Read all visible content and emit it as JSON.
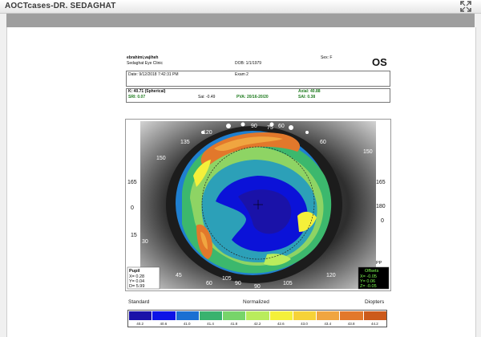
{
  "window": {
    "title": "AOCTcases-DR. SEDAGHAT"
  },
  "patient": {
    "name": "ebrahimi,vajiheh",
    "clinic": "Sedaghat Eye Clinic",
    "dob": "DOB: 1/1/1979",
    "sex": "Sex: F",
    "eye": "OS",
    "date": "Date: 9/12/2018 7:42:31 PM",
    "exam": "Exam 2"
  },
  "indices": {
    "k": "K: 40.71 (Spherical)",
    "axial": "Axial: 40.88",
    "sri": "SRI: 0.07",
    "sai_label": "Sai: -0.49",
    "pva": "PVA: 20/16-20/20",
    "sai": "SAI: 0.38"
  },
  "map": {
    "axis_labels": [
      "120",
      "90",
      "60",
      "135",
      "150",
      "165",
      "0",
      "15",
      "30",
      "45",
      "60",
      "90",
      "105",
      "120",
      "150",
      "165",
      "180",
      "0",
      "60",
      "75",
      "90",
      "105"
    ],
    "pupil": {
      "title": "Pupil",
      "x": "X= 0.28",
      "y": "Y= 0.04",
      "d": "D= 5.99"
    },
    "offsets": {
      "title": "Offsets",
      "x": "X= -0.05",
      "y": "Y= 0.06",
      "z": "Z= -0.05"
    },
    "pp": "PP"
  },
  "scale_labels": {
    "standard": "Standard",
    "normalized": "Normalized",
    "diopters": "Diopters"
  },
  "legend": {
    "colors": [
      "#1a12a8",
      "#0d13e6",
      "#1a6fd2",
      "#39b26e",
      "#77d46a",
      "#b9ec5c",
      "#f4f03a",
      "#f6d238",
      "#f0a540",
      "#e2782b",
      "#cc5a1b"
    ],
    "values": [
      "40.2",
      "40.6",
      "41.0",
      "41.4",
      "41.8",
      "42.2",
      "42.6",
      "43.0",
      "43.4",
      "43.8",
      "44.2"
    ]
  }
}
